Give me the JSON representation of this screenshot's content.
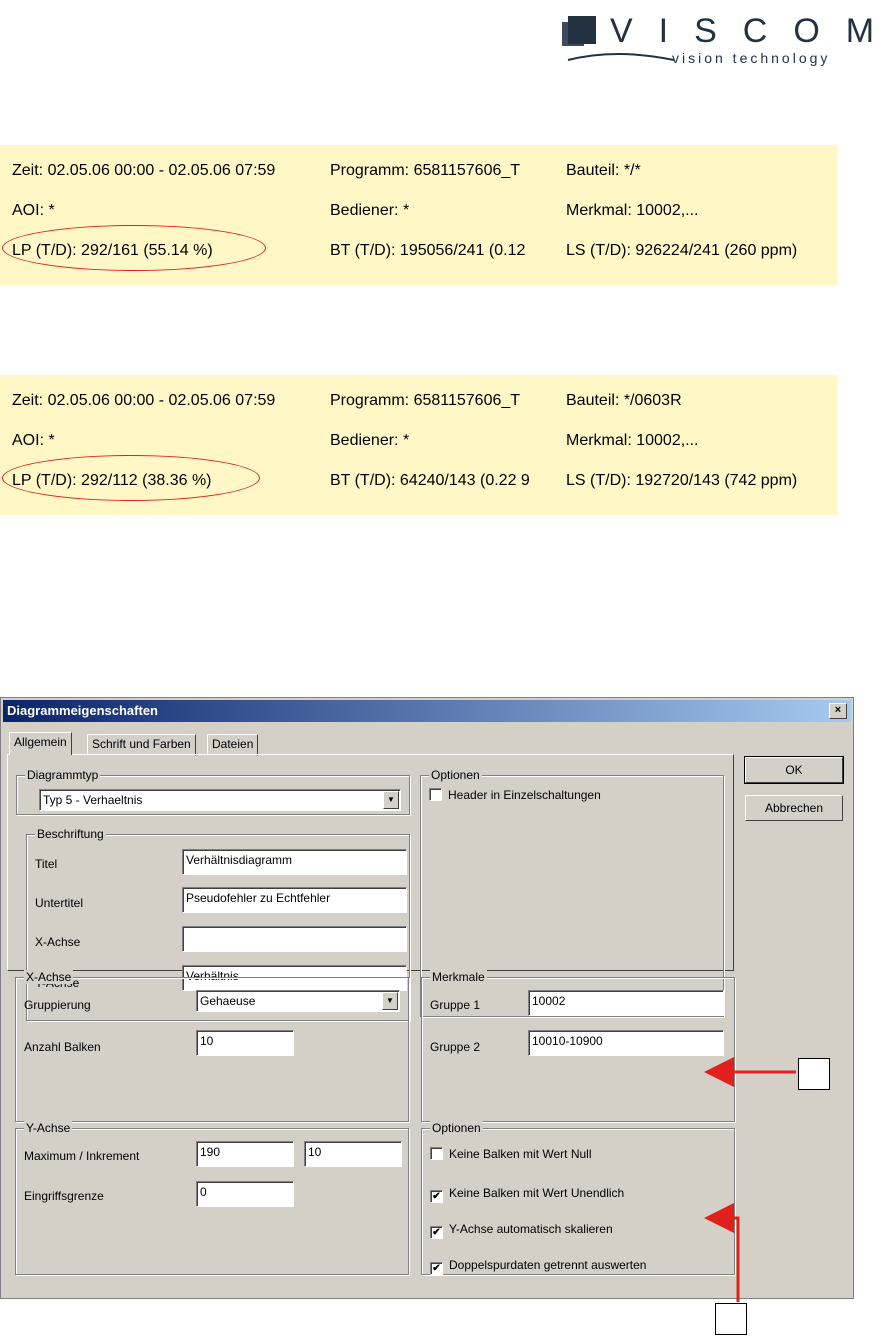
{
  "logo": {
    "wordmark": "VISCOM",
    "tagline": "vision technology",
    "brand_color": "#24323f"
  },
  "panel1": {
    "zeit": "Zeit: 02.05.06 00:00 - 02.05.06 07:59",
    "programm": "Programm: 6581157606_T",
    "bauteil": "Bauteil: */*",
    "aoi": "AOI: *",
    "bediener": "Bediener: *",
    "merkmal": "Merkmal: 10002,...",
    "lp": "LP (T/D): 292/161 (55.14 %)",
    "bt": "BT (T/D): 195056/241 (0.12",
    "ls": "LS (T/D): 926224/241 (260 ppm)"
  },
  "panel2": {
    "zeit": "Zeit: 02.05.06 00:00 - 02.05.06 07:59",
    "programm": "Programm: 6581157606_T",
    "bauteil": "Bauteil: */0603R",
    "aoi": "AOI: *",
    "bediener": "Bediener: *",
    "merkmal": "Merkmal: 10002,...",
    "lp": "LP (T/D): 292/112 (38.36 %)",
    "bt": "BT (T/D): 64240/143 (0.22 9",
    "ls": "LS (T/D): 192720/143 (742 ppm)"
  },
  "colors": {
    "panel_bg": "#fff8c6",
    "highlight_red": "#e0201c"
  },
  "dialog": {
    "title": "Diagrammeigenschaften",
    "close_glyph": "×",
    "tabs": [
      "Allgemein",
      "Schrift und Farben",
      "Dateien"
    ],
    "ok_label": "OK",
    "cancel_label": "Abbrechen",
    "diagrammtyp": {
      "group": "Diagrammtyp",
      "value": "Typ 5 - Verhaeltnis"
    },
    "beschriftung": {
      "group": "Beschriftung",
      "titel_label": "Titel",
      "titel_value": "Verhältnisdiagramm",
      "untertitel_label": "Untertitel",
      "untertitel_value": "Pseudofehler zu Echtfehler",
      "xachse_label": "X-Achse",
      "xachse_value": "",
      "yachse_label": "Y-Achse",
      "yachse_value": "Verhältnis"
    },
    "optionen_top": {
      "group": "Optionen",
      "header_label": "Header in Einzelschaltungen",
      "header_checked": ""
    },
    "xachse": {
      "group": "X-Achse",
      "gruppierung_label": "Gruppierung",
      "gruppierung_value": "Gehaeuse",
      "anzahl_label": "Anzahl Balken",
      "anzahl_value": "10"
    },
    "yachse": {
      "group": "Y-Achse",
      "max_label": "Maximum / Inkrement",
      "max_value": "190",
      "inkrement_value": "10",
      "grenze_label": "Eingriffsgrenze",
      "grenze_value": "0"
    },
    "merkmale": {
      "group": "Merkmale",
      "g1_label": "Gruppe 1",
      "g1_value": "10002",
      "g2_label": "Gruppe 2",
      "g2_value": "10010-10900"
    },
    "optionen_bottom": {
      "group": "Optionen",
      "items": [
        {
          "label": "Keine Balken mit Wert Null",
          "check": ""
        },
        {
          "label": "Keine Balken mit Wert Unendlich",
          "check": "✔"
        },
        {
          "label": "Y-Achse automatisch skalieren",
          "check": "✔"
        },
        {
          "label": "Doppelspurdaten getrennt auswerten",
          "check": "✔"
        }
      ]
    }
  },
  "select_arrow_glyph": "▼"
}
